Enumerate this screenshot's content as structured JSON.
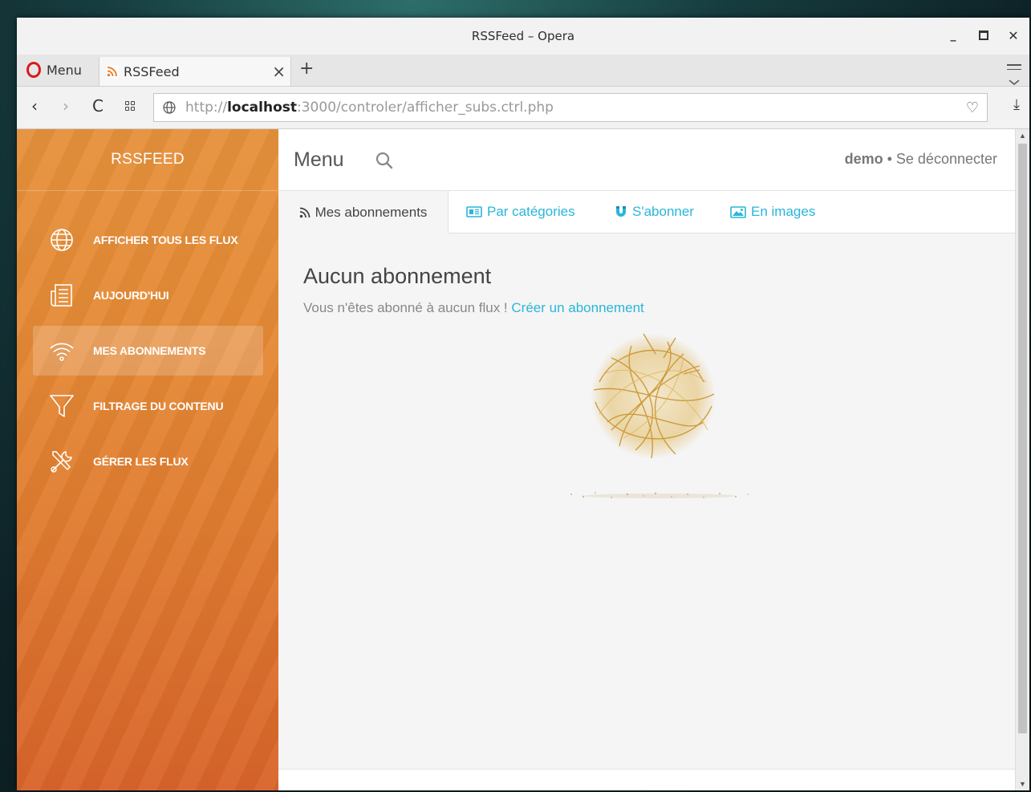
{
  "window": {
    "title": "RSSFeed – Opera"
  },
  "browser": {
    "menu_label": "Menu",
    "tab_title": "RSSFeed",
    "new_tab": "+",
    "url_scheme": "http://",
    "url_host": "localhost",
    "url_rest": ":3000/controler/afficher_subs.ctrl.php"
  },
  "sidebar": {
    "brand": "RSSFEED",
    "items": [
      {
        "label": "AFFICHER TOUS LES FLUX",
        "icon": "globe-icon"
      },
      {
        "label": "AUJOURD'HUI",
        "icon": "newspaper-icon"
      },
      {
        "label": "MES ABONNEMENTS",
        "icon": "wifi-icon",
        "active": true
      },
      {
        "label": "FILTRAGE DU CONTENU",
        "icon": "funnel-icon"
      },
      {
        "label": "GÉRER LES FLUX",
        "icon": "tools-icon"
      }
    ]
  },
  "topnav": {
    "menu": "Menu",
    "user": "demo",
    "separator": " • ",
    "logout": "Se déconnecter"
  },
  "tabs": [
    {
      "label": "Mes abonnements",
      "icon": "rss-icon"
    },
    {
      "label": "Par catégories",
      "icon": "newspaper-icon"
    },
    {
      "label": "S'abonner",
      "icon": "magnet-icon"
    },
    {
      "label": "En images",
      "icon": "image-icon"
    }
  ],
  "content": {
    "heading": "Aucun abonnement",
    "message": "Vous n'êtes abonné à aucun flux ! ",
    "link": "Créer un abonnement"
  },
  "colors": {
    "accent": "#29b6d9",
    "sidebar_top": "#e6913c",
    "sidebar_bottom": "#d9642a"
  }
}
